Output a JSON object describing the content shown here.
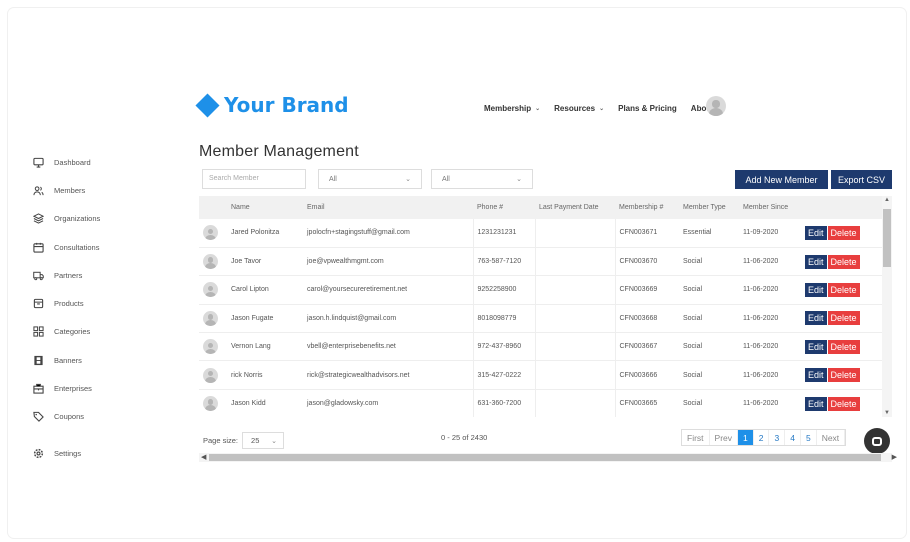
{
  "brand": {
    "name": "Your Brand",
    "color": "#1e90e8"
  },
  "topnav": [
    {
      "label": "Membership",
      "dropdown": true
    },
    {
      "label": "Resources",
      "dropdown": true
    },
    {
      "label": "Plans & Pricing",
      "dropdown": false
    },
    {
      "label": "About",
      "dropdown": false
    }
  ],
  "sidebar": {
    "items": [
      {
        "label": "Dashboard",
        "icon": "monitor-icon"
      },
      {
        "label": "Members",
        "icon": "users-icon"
      },
      {
        "label": "Organizations",
        "icon": "layers-icon"
      },
      {
        "label": "Consultations",
        "icon": "calendar-icon"
      },
      {
        "label": "Partners",
        "icon": "truck-icon"
      },
      {
        "label": "Products",
        "icon": "box-icon"
      },
      {
        "label": "Categories",
        "icon": "grid-icon"
      },
      {
        "label": "Banners",
        "icon": "film-icon"
      },
      {
        "label": "Enterprises",
        "icon": "building-icon"
      },
      {
        "label": "Coupons",
        "icon": "tag-icon"
      }
    ],
    "settings": {
      "label": "Settings",
      "icon": "gear-icon"
    }
  },
  "page": {
    "title": "Member Management"
  },
  "filters": {
    "search_placeholder": "Search Member",
    "select1": "All",
    "select2": "All"
  },
  "actions": {
    "add_member": "Add New Member",
    "export": "Export CSV"
  },
  "table": {
    "columns": [
      "",
      "Name",
      "Email",
      "Phone #",
      "Last Payment Date",
      "Membership #",
      "Member Type",
      "Member Since",
      ""
    ],
    "edit_label": "Edit",
    "delete_label": "Delete",
    "rows": [
      {
        "name": "Jared Polonitza",
        "email": "jpolocfn+stagingstuff@gmail.com",
        "phone": "1231231231",
        "last_payment": "",
        "membership": "CFN003671",
        "type": "Essential",
        "since": "11-09-2020"
      },
      {
        "name": "Joe Tavor",
        "email": "joe@vpwealthmgmt.com",
        "phone": "763-587-7120",
        "last_payment": "",
        "membership": "CFN003670",
        "type": "Social",
        "since": "11-06-2020"
      },
      {
        "name": "Carol Lipton",
        "email": "carol@yoursecureretirement.net",
        "phone": "9252258900",
        "last_payment": "",
        "membership": "CFN003669",
        "type": "Social",
        "since": "11-06-2020"
      },
      {
        "name": "Jason Fugate",
        "email": "jason.h.lindquist@gmail.com",
        "phone": "8018098779",
        "last_payment": "",
        "membership": "CFN003668",
        "type": "Social",
        "since": "11-06-2020"
      },
      {
        "name": "Vernon Lang",
        "email": "vbell@enterprisebenefits.net",
        "phone": "972-437-8960",
        "last_payment": "",
        "membership": "CFN003667",
        "type": "Social",
        "since": "11-06-2020"
      },
      {
        "name": "rick Norris",
        "email": "rick@strategicwealthadvisors.net",
        "phone": "315-427-0222",
        "last_payment": "",
        "membership": "CFN003666",
        "type": "Social",
        "since": "11-06-2020"
      },
      {
        "name": "Jason Kidd",
        "email": "jason@gladowsky.com",
        "phone": "631-360-7200",
        "last_payment": "",
        "membership": "CFN003665",
        "type": "Social",
        "since": "11-06-2020"
      }
    ]
  },
  "footer": {
    "page_size_label": "Page size:",
    "page_size": "25",
    "range": "0 - 25 of 2430",
    "pager": [
      "First",
      "Prev",
      "1",
      "2",
      "3",
      "4",
      "5",
      "Next"
    ],
    "active_page": "1"
  },
  "colors": {
    "primary_dark": "#1e3a6e",
    "danger": "#e83e3e",
    "accent": "#1e90e8"
  }
}
